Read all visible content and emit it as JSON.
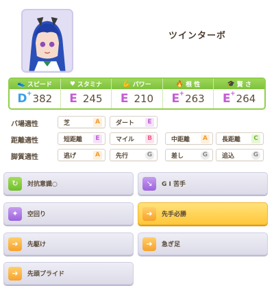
{
  "character": {
    "name": "ツインターボ"
  },
  "stats": [
    {
      "label": "スピード",
      "icon": "shoe-icon",
      "rank": "D",
      "plus": "+",
      "value": "382"
    },
    {
      "label": "スタミナ",
      "icon": "heart-icon",
      "rank": "E",
      "plus": "",
      "value": "245"
    },
    {
      "label": "パワー",
      "icon": "muscle-icon",
      "rank": "E",
      "plus": "",
      "value": "210"
    },
    {
      "label": "根 性",
      "icon": "flame-icon",
      "rank": "E",
      "plus": "+",
      "value": "263"
    },
    {
      "label": "賢 さ",
      "icon": "graduation-cap-icon",
      "rank": "E",
      "plus": "+",
      "value": "264"
    }
  ],
  "aptitudes": {
    "surface": {
      "label": "バ場適性",
      "items": [
        {
          "name": "芝",
          "grade": "A"
        },
        {
          "name": "ダート",
          "grade": "E"
        }
      ]
    },
    "distance": {
      "label": "距離適性",
      "items": [
        {
          "name": "短距離",
          "grade": "E"
        },
        {
          "name": "マイル",
          "grade": "B"
        },
        {
          "name": "中距離",
          "grade": "A"
        },
        {
          "name": "長距離",
          "grade": "C"
        }
      ]
    },
    "strategy": {
      "label": "脚質適性",
      "items": [
        {
          "name": "逃げ",
          "grade": "A"
        },
        {
          "name": "先行",
          "grade": "G"
        },
        {
          "name": "差し",
          "grade": "G"
        },
        {
          "name": "追込",
          "grade": "G"
        }
      ]
    }
  },
  "skills": [
    {
      "name": "対抗意識○",
      "icon": "green"
    },
    {
      "name": "G I 苦手",
      "icon": "purple"
    },
    {
      "name": "空回り",
      "icon": "purple"
    },
    {
      "name": "先手必勝",
      "icon": "orange",
      "highlight": true
    },
    {
      "name": "先駆け",
      "icon": "orange"
    },
    {
      "name": "急ぎ足",
      "icon": "orange"
    },
    {
      "name": "先頭プライド",
      "icon": "orange"
    }
  ],
  "colors": {
    "stat_header": "#8cd049",
    "gold_skill": "#ffc73b",
    "rank_D": "#3aa0e8",
    "rank_E": "#c35bd6"
  }
}
